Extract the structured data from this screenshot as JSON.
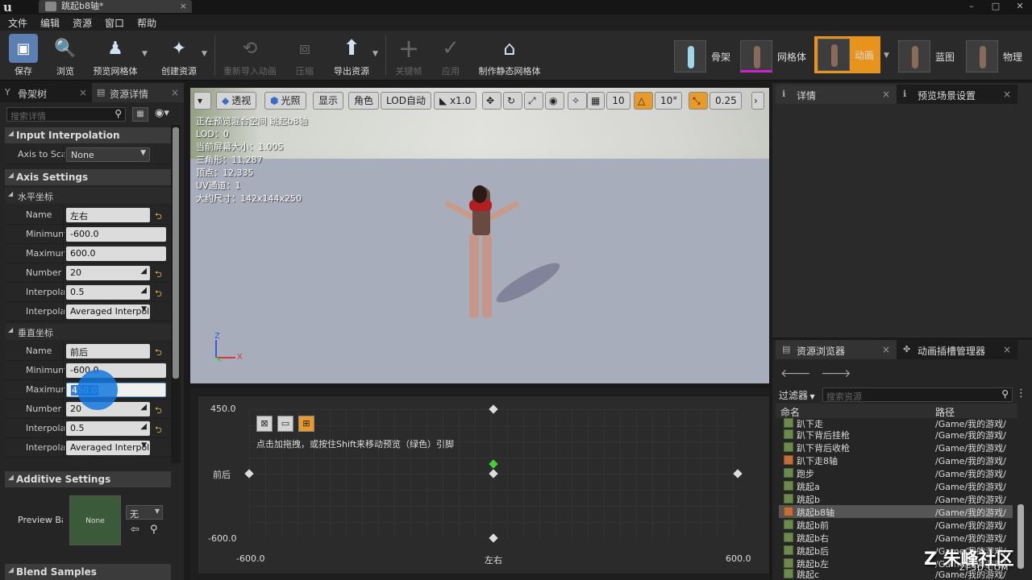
{
  "window": {
    "tab_title": "跳起b8轴*",
    "controls": [
      "–",
      "□",
      "✕"
    ]
  },
  "menu": [
    "文件",
    "编辑",
    "资源",
    "窗口",
    "帮助"
  ],
  "toolbar": {
    "save": "保存",
    "browse": "浏览",
    "preview_mesh": "预览网格体",
    "create_asset": "创建资源",
    "reimport_anim": "重新导入动画",
    "compress": "压缩",
    "export_asset": "导出资源",
    "key_frame": "关键帧",
    "apply": "应用",
    "make_static_mesh": "制作静态网格体"
  },
  "modes": {
    "skeleton": "骨架",
    "mesh": "网格体",
    "animation": "动画",
    "blueprint": "蓝图",
    "physics": "物理"
  },
  "left_panel": {
    "tab_skeleton_tree": "骨架树",
    "tab_asset_details": "资源详情",
    "search_placeholder": "搜索详情",
    "input_interpolation": "Input Interpolation",
    "axis_to_scale_label": "Axis to Scale Animation",
    "axis_to_scale_value": "None",
    "axis_settings": "Axis Settings",
    "horizontal": {
      "header": "水平坐标",
      "name_label": "Name",
      "name_value": "左右",
      "min_label": "Minimum Axis Value",
      "min_value": "-600.0",
      "max_label": "Maximum Axis Value",
      "max_value": "600.0",
      "num_label": "Number of Grid Divisions",
      "num_value": "20",
      "interp_label": "Interpolation Time",
      "interp_value": "0.5",
      "interp_type_label": "Interpolation Type",
      "interp_type_value": "Averaged Interpolation"
    },
    "vertical": {
      "header": "垂直坐标",
      "name_label": "Name",
      "name_value": "前后",
      "min_label": "Minimum Axis Value",
      "min_value": "-600.0",
      "max_label": "Maximum Axis Value",
      "max_value": "450.0",
      "num_label": "Number of Grid Divisions",
      "num_value": "20",
      "interp_label": "Interpolation Time",
      "interp_value": "0.5",
      "interp_type_label": "Interpolation Type",
      "interp_type_value": "Averaged Interpolation"
    },
    "additive_settings": "Additive Settings",
    "preview_base_label": "Preview Base Pose",
    "preview_thumb": "None",
    "preview_dropdown": "无",
    "blend_samples": "Blend Samples"
  },
  "viewport": {
    "perspective": "透视",
    "lighting": "光照",
    "show": "显示",
    "character": "角色",
    "lod_auto": "LOD自动",
    "speed": "x1.0",
    "grid_snap": "10",
    "angle_snap": "10°",
    "scale_snap": "0.25",
    "info": [
      "正在预览混合空间 跳起b8轴",
      "LOD：0",
      "当前屏幕大小：1.005",
      "三角形：11,287",
      "顶点：12,335",
      "UV通道：1",
      "大约尺寸：142x144x250"
    ],
    "gizmo_z": "Z",
    "gizmo_x": "X"
  },
  "graph": {
    "y_max": "450.0",
    "y_min": "-600.0",
    "y_axis_name": "前后",
    "x_min": "-600.0",
    "x_max": "600.0",
    "x_axis_name": "左右",
    "hint": "点击加拖拽，或按住Shift来移动预览（绿色）引脚"
  },
  "right_top": {
    "tab_details": "详情",
    "tab_preview_scene": "预览场景设置"
  },
  "asset_browser": {
    "tab_content": "资源浏览器",
    "tab_anim_slots": "动画插槽管理器",
    "filter": "过滤器",
    "search_placeholder": "搜索资源",
    "col_name": "命名",
    "col_path": "路径",
    "rows": [
      {
        "name": "趴下走",
        "path": "/Game/我的游戏/"
      },
      {
        "name": "趴下背后挂枪",
        "path": "/Game/我的游戏/"
      },
      {
        "name": "趴下背后收枪",
        "path": "/Game/我的游戏/"
      },
      {
        "name": "趴下走8轴",
        "path": "/Game/我的游戏/"
      },
      {
        "name": "跑步",
        "path": "/Game/我的游戏/"
      },
      {
        "name": "跳起a",
        "path": "/Game/我的游戏/"
      },
      {
        "name": "跳起b",
        "path": "/Game/我的游戏/"
      },
      {
        "name": "跳起b8轴",
        "path": "/Game/我的游戏/"
      },
      {
        "name": "跳起b前",
        "path": "/Game/我的游戏/"
      },
      {
        "name": "跳起b右",
        "path": "/Game/我的游戏/"
      },
      {
        "name": "跳起b后",
        "path": "/Game/我的游戏/"
      },
      {
        "name": "跳起b左",
        "path": "/Game/我的游戏/"
      },
      {
        "name": "跳起c",
        "path": "/Game/我的游戏/"
      }
    ]
  },
  "watermark": {
    "main": "Z 朱峰社区",
    "sub": "ZF3D.COM"
  }
}
